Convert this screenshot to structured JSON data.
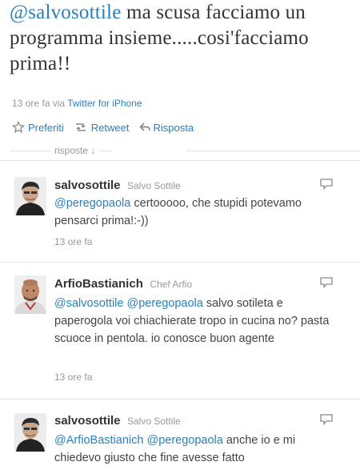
{
  "main_tweet": {
    "mention": "@salvosottile",
    "text": " ma scusa facciamo un programma insieme.....cosi'facciamo prima!!",
    "time": "13 ore fa",
    "via_label": "via",
    "via_source": "Twitter for iPhone"
  },
  "actions": {
    "favorite": "Preferiti",
    "retweet": "Retweet",
    "reply": "Risposta"
  },
  "replies_label": "risposte ↓",
  "replies": [
    {
      "username": "salvosottile",
      "fullname": "Salvo Sottile",
      "mention": "@peregopaola",
      "text": " certooooo, che stupidi potevamo pensarci prima!:-))",
      "time": "13 ore fa"
    },
    {
      "username": "ArfioBastianich",
      "fullname": "Chef Arfio",
      "mention1": "@salvosottile",
      "mention2": "@peregopaola",
      "text": " salvo sotileta e paperogola voi chiachierate tropo in cucina no? pasta scuoce in pentola. io conosce buon agente",
      "time": "13 ore fa"
    },
    {
      "username": "salvosottile",
      "fullname": "Salvo Sottile",
      "mention1": "@ArfioBastianich",
      "mention2": "@peregopaola",
      "text": " anche io e mi chiedevo giusto che fine avesse fatto"
    }
  ],
  "colors": {
    "link": "#2a80b9",
    "muted": "#999999",
    "text": "#333333"
  }
}
